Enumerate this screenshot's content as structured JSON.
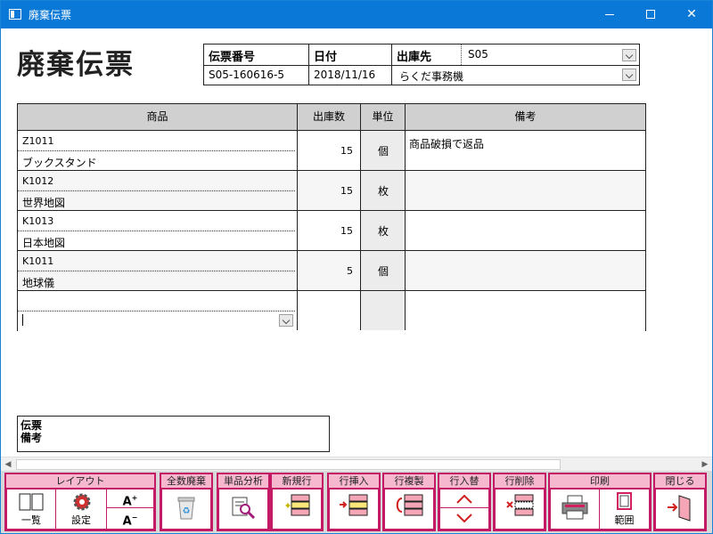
{
  "window": {
    "title": "廃棄伝票"
  },
  "doc": {
    "title": "廃棄伝票"
  },
  "header": {
    "slip_no_label": "伝票番号",
    "slip_no": "S05-160616-5",
    "date_label": "日付",
    "date": "2018/11/16",
    "dest_label": "出庫先",
    "dest_code": "S05",
    "dest_name": "らくだ事務機"
  },
  "grid": {
    "columns": [
      "商品",
      "出庫数",
      "単位",
      "備考"
    ],
    "rows": [
      {
        "code": "Z1011",
        "name": "ブックスタンド",
        "qty": "15",
        "unit": "個",
        "note": "商品破損で返品"
      },
      {
        "code": "K1012",
        "name": "世界地図",
        "qty": "15",
        "unit": "枚",
        "note": ""
      },
      {
        "code": "K1013",
        "name": "日本地図",
        "qty": "15",
        "unit": "枚",
        "note": ""
      },
      {
        "code": "K1011",
        "name": "地球儀",
        "qty": "5",
        "unit": "個",
        "note": ""
      }
    ]
  },
  "remarks": {
    "label": "伝票\n備考"
  },
  "toolbar": {
    "layout": {
      "label": "レイアウト",
      "list": "一覧",
      "settings": "設定"
    },
    "discard_all": "全数廃棄",
    "item_analysis": "単品分析",
    "new_row": "新規行",
    "insert_row": "行挿入",
    "copy_row": "行複製",
    "swap_row": "行入替",
    "delete_row": "行削除",
    "print": {
      "label": "印刷",
      "range": "範囲"
    },
    "close": "閉じる"
  },
  "colors": {
    "titlebar": "#0a78d7",
    "toolbar_group": "#c41a66",
    "toolbar_label": "#f6b8cf",
    "grid_header": "#d0d0d0"
  },
  "icons": [
    "app-icon",
    "minimize-icon",
    "maximize-icon",
    "close-icon",
    "chevron-down-icon",
    "list-view-icon",
    "gear-icon",
    "font-increase-icon",
    "font-decrease-icon",
    "recycle-bin-icon",
    "magnifier-doc-icon",
    "new-row-icon",
    "insert-row-icon",
    "copy-row-icon",
    "arrow-up-icon",
    "arrow-down-icon",
    "delete-row-icon",
    "printer-icon",
    "print-range-icon",
    "exit-door-icon"
  ]
}
